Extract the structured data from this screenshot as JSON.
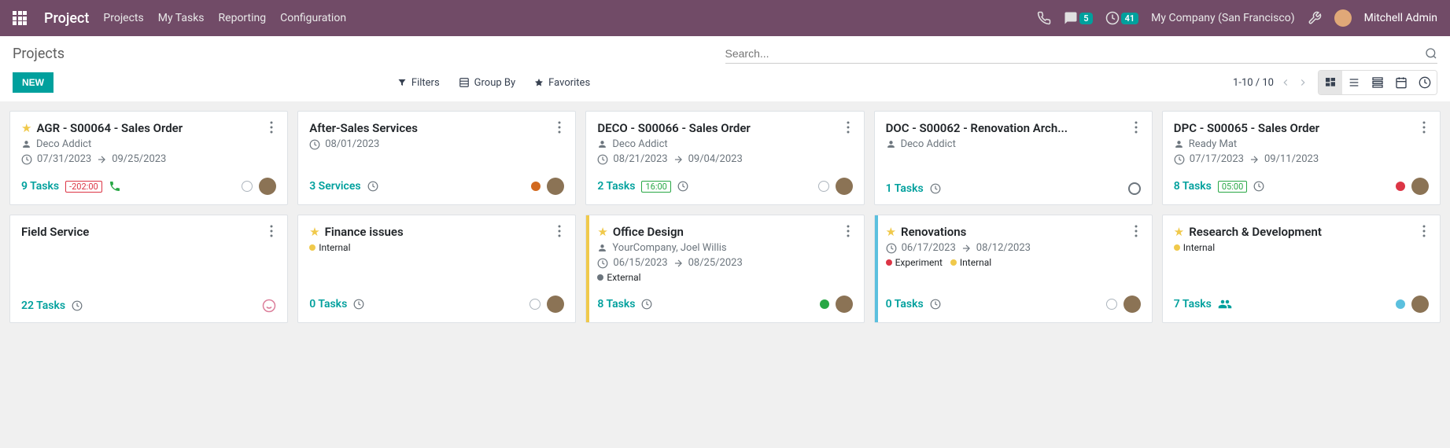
{
  "navbar": {
    "app_title": "Project",
    "menu": [
      "Projects",
      "My Tasks",
      "Reporting",
      "Configuration"
    ],
    "chat_badge": "5",
    "clock_badge": "41",
    "company": "My Company (San Francisco)",
    "user": "Mitchell Admin"
  },
  "control_panel": {
    "breadcrumb": "Projects",
    "new_label": "NEW",
    "search_placeholder": "Search...",
    "filters_label": "Filters",
    "group_by_label": "Group By",
    "favorites_label": "Favorites",
    "pager": "1-10 / 10"
  },
  "cards": [
    {
      "starred": true,
      "title": "AGR - S00064 - Sales Order",
      "customer": "Deco Addict",
      "date_start": "07/31/2023",
      "date_end": "09/25/2023",
      "tasks": "9 Tasks",
      "time": "-202:00",
      "time_color": "red",
      "phone": true,
      "avatar": true,
      "state": "empty"
    },
    {
      "starred": false,
      "no_star": true,
      "title": "After-Sales Services",
      "date_single": "08/01/2023",
      "tasks": "3 Services",
      "clock": true,
      "avatar": true,
      "state": "orange"
    },
    {
      "starred": false,
      "no_star": true,
      "title": "DECO - S00066 - Sales Order",
      "customer": "Deco Addict",
      "date_start": "08/21/2023",
      "date_end": "09/04/2023",
      "tasks": "2 Tasks",
      "time": "16:00",
      "time_color": "green",
      "clock": true,
      "avatar": true,
      "state": "empty"
    },
    {
      "starred": false,
      "no_star": true,
      "title": "DOC - S00062 - Renovation Arch...",
      "customer": "Deco Addict",
      "tasks": "1 Tasks",
      "clock": true,
      "state": "ring"
    },
    {
      "starred": false,
      "no_star": true,
      "title": "DPC - S00065 - Sales Order",
      "customer": "Ready Mat",
      "date_start": "07/17/2023",
      "date_end": "09/11/2023",
      "tasks": "8 Tasks",
      "time": "05:00",
      "time_color": "green",
      "clock": true,
      "avatar": true,
      "state": "red"
    },
    {
      "starred": false,
      "no_star": true,
      "title": "Field Service",
      "tasks": "22 Tasks",
      "clock": true,
      "state": "smile"
    },
    {
      "starred": true,
      "title": "Finance issues",
      "tags": [
        {
          "label": "Internal",
          "color": "#f0c94b"
        }
      ],
      "tasks": "0 Tasks",
      "clock": true,
      "avatar": true,
      "state": "empty"
    },
    {
      "starred": true,
      "accent": "#f0c94b",
      "title": "Office Design",
      "customer": "YourCompany, Joel Willis",
      "date_start": "06/15/2023",
      "date_end": "08/25/2023",
      "tags": [
        {
          "label": "External",
          "color": "#6c757d"
        }
      ],
      "tasks": "8 Tasks",
      "clock": true,
      "avatar": true,
      "state": "green"
    },
    {
      "starred": true,
      "accent": "#5bc0de",
      "title": "Renovations",
      "date_start": "06/17/2023",
      "date_end": "08/12/2023",
      "tags": [
        {
          "label": "Experiment",
          "color": "#dc3545"
        },
        {
          "label": "Internal",
          "color": "#f0c94b"
        }
      ],
      "tasks": "0 Tasks",
      "clock": true,
      "avatar": true,
      "state": "empty"
    },
    {
      "starred": true,
      "title": "Research & Development",
      "tags": [
        {
          "label": "Internal",
          "color": "#f0c94b"
        }
      ],
      "tasks": "7 Tasks",
      "people": true,
      "avatar": true,
      "state": "blue"
    }
  ]
}
